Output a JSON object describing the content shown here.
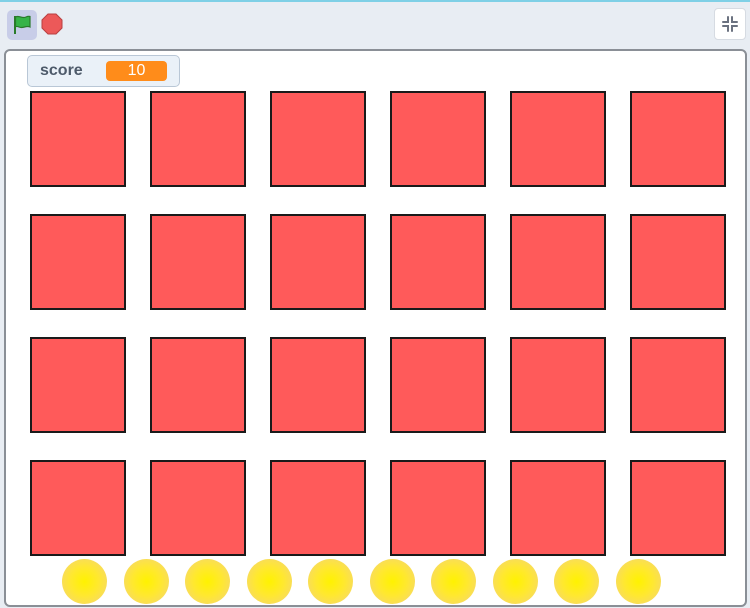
{
  "toolbar": {
    "green_flag_icon": "green-flag-icon",
    "stop_icon": "stop-sign-icon",
    "fullscreen_icon": "unfullscreen-icon"
  },
  "score_monitor": {
    "label": "score",
    "value": "10"
  },
  "grid": {
    "rows": 4,
    "columns": 6,
    "tile_color": "#ff5a5a"
  },
  "coins": {
    "count": 10,
    "color": "#fff200"
  },
  "colors": {
    "monitor_value_bg": "#ff8c1a",
    "flag_green": "#36b347",
    "stop_red": "#ec5959",
    "stage_border": "#8a8f96"
  }
}
